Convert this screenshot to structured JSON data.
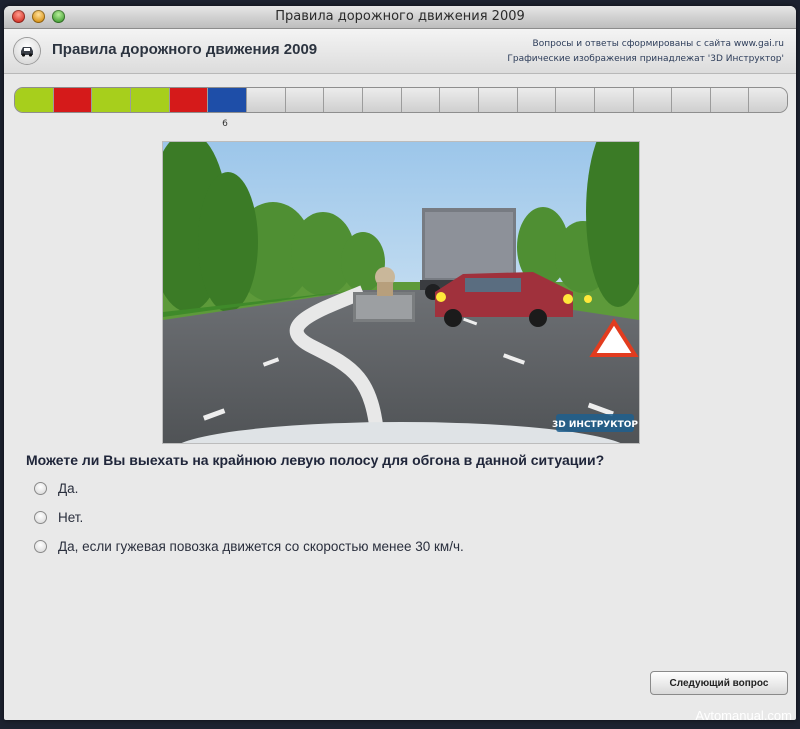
{
  "window": {
    "title": "Правила дорожного движения 2009"
  },
  "header": {
    "app_title": "Правила дорожного движения 2009",
    "credit_line1": "Вопросы и ответы сформированы с сайта www.gai.ru",
    "credit_line2": "Графические изображения принадлежат '3D Инструктор'",
    "logo_icon": "car-icon"
  },
  "progress": {
    "segments": [
      "correct",
      "wrong",
      "correct",
      "correct",
      "wrong",
      "current",
      "empty",
      "empty",
      "empty",
      "empty",
      "empty",
      "empty",
      "empty",
      "empty",
      "empty",
      "empty",
      "empty",
      "empty",
      "empty",
      "empty"
    ],
    "current_number": "6",
    "colors": {
      "correct": "#a7cf1c",
      "wrong": "#d51a1a",
      "current": "#1e4ea8",
      "empty": "#dadada"
    }
  },
  "scene": {
    "logo_text": "3D ИНСТРУКТОР"
  },
  "question": {
    "text": "Можете ли Вы выехать на крайнюю левую полосу для обгона в данной ситуации?",
    "answers": [
      "Да.",
      "Нет.",
      "Да, если гужевая повозка движется со скоростью менее 30 км/ч."
    ]
  },
  "footer": {
    "next_button": "Следующий вопрос"
  },
  "watermark": "Avtomanual.com"
}
